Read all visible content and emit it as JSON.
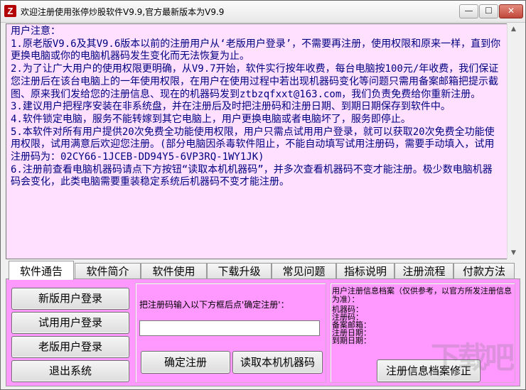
{
  "window": {
    "title": "欢迎注册使用张停炒股软件V9.9,官方最新版本为V9.9",
    "app_icon": "Z",
    "controls": {
      "minimize": "—",
      "maximize": "☐",
      "close": "✕"
    }
  },
  "notice": {
    "text": "用户注意：\n1.原老版V9.6及其V9.6版本以前的注册用户从‘老版用户登录’，不需要再注册，使用权限和原来一样，直到你更换电脑或你的电脑机器码发生变化而无法恢复为止。\n2.为了让广大用户的使用权限更明确，从V9.7开始，软件实行按年收费，每台电脑按100元/年收费，我们保证您注册后在该台电脑上的一年使用权限，在用户在使用过程中若出现机器码变化等问题只需用备案邮箱把提示截图、原来我们发给您的注册信息、现在的机器码发到ztbzqfxxt@163.com，我们负责免费给你重新注册。\n3.建议用户把程序安装在非系统盘，并在注册后及时把注册码和注册日期、到期日期保存到软件中。\n4.软件锁定电脑，服务不能转嫁到其它电脑上，用户更换电脑或者电脑坏了，服务即停止。\n5.本软件对所有用户提供20次免费全功能使用权限，用户只需点试用用户登录，就可以获取20次免费全功能使用权限，试用满意后欢迎您注册。(部分电脑因杀毒软件阻止，不能自动填写试用注册码，需要手动填入，试用注册码为：02CY66-1JCEB-DD94Y5-6VP3RQ-1WY1JK)\n6.注册前查看电脑机器码请点下方按钮“读取本机机器码”，并多次查看机器码不变才能注册。极少数电脑机器码会变化，此类电脑需要重装稳定系统后机器码不变才能注册。"
  },
  "scrollbar": {
    "up": "▲",
    "down": "▼"
  },
  "tabs": [
    {
      "label": "软件通告"
    },
    {
      "label": "软件简介"
    },
    {
      "label": "软件使用"
    },
    {
      "label": "下载升级"
    },
    {
      "label": "常见问题"
    },
    {
      "label": "指标说明"
    },
    {
      "label": "注册流程"
    },
    {
      "label": "付款方法"
    }
  ],
  "left_buttons": {
    "new_user": "新版用户登录",
    "trial_user": "试用用户登录",
    "old_user": "老版用户登录",
    "exit": "退出系统"
  },
  "registration": {
    "label": "把注册码输入以下方框后点'确定注册'：",
    "input_value": "",
    "confirm": "确定注册",
    "read_machine_code": "读取本机机器码"
  },
  "info_archive": {
    "note": "用户注册信息档案（仅供参考，以官方所发注册信息为准）：",
    "fields": [
      "机器码：",
      "注册码：",
      "备案邮箱：",
      "注册日期：",
      "到期日期："
    ],
    "fix_button": "注册信息档案修正"
  },
  "watermark": "下载吧",
  "colors": {
    "notice_background": "#ffe0ff",
    "notice_text": "#000080",
    "panel_background": "#ff99ff"
  }
}
